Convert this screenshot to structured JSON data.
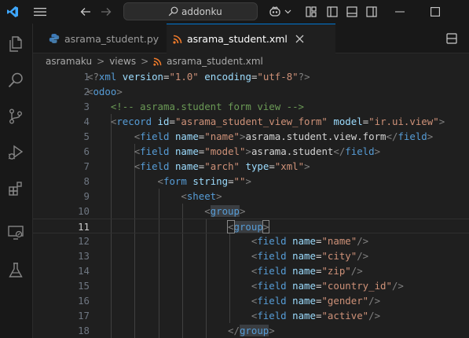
{
  "titlebar": {
    "search_text": "addonku",
    "colors": {
      "accent": "#0078d4",
      "logo": "#3ea7ff"
    }
  },
  "activity_bar": [
    "explorer-icon",
    "search-icon",
    "source-control-icon",
    "run-debug-icon",
    "extensions-icon",
    "remote-explorer-icon",
    "testing-icon"
  ],
  "tabs": [
    {
      "label": "asrama_student.py",
      "icon": "python-icon",
      "active": false
    },
    {
      "label": "asrama_student.xml",
      "icon": "rss-xml-icon",
      "active": true
    }
  ],
  "breadcrumb": {
    "items": [
      "asramaku",
      "views",
      "asrama_student.xml"
    ],
    "separator": ">"
  },
  "editor": {
    "current_line": 11,
    "lines": [
      {
        "n": "1",
        "tokens": [
          [
            "c-bracket",
            "<?"
          ],
          [
            "c-tag",
            "xml"
          ],
          [
            "c-txt",
            " "
          ],
          [
            "c-attr",
            "version"
          ],
          [
            "c-txt",
            "="
          ],
          [
            "c-str",
            "\"1.0\""
          ],
          [
            "c-txt",
            " "
          ],
          [
            "c-attr",
            "encoding"
          ],
          [
            "c-txt",
            "="
          ],
          [
            "c-str",
            "\"utf-8\""
          ],
          [
            "c-bracket",
            "?>"
          ]
        ]
      },
      {
        "n": "2",
        "tokens": [
          [
            "c-bracket",
            "<"
          ],
          [
            "c-tag",
            "odoo"
          ],
          [
            "c-bracket",
            ">"
          ]
        ]
      },
      {
        "n": "3",
        "tokens": [
          [
            "c-txt",
            "    "
          ],
          [
            "c-cmt",
            "<!-- asrama.student form view -->"
          ]
        ]
      },
      {
        "n": "4",
        "tokens": [
          [
            "c-txt",
            "    "
          ],
          [
            "c-bracket",
            "<"
          ],
          [
            "c-tag",
            "record"
          ],
          [
            "c-txt",
            " "
          ],
          [
            "c-attr",
            "id"
          ],
          [
            "c-txt",
            "="
          ],
          [
            "c-str",
            "\"asrama_student_view_form\""
          ],
          [
            "c-txt",
            " "
          ],
          [
            "c-attr",
            "model"
          ],
          [
            "c-txt",
            "="
          ],
          [
            "c-str",
            "\"ir.ui.view\""
          ],
          [
            "c-bracket",
            ">"
          ]
        ]
      },
      {
        "n": "5",
        "tokens": [
          [
            "c-txt",
            "        "
          ],
          [
            "c-bracket",
            "<"
          ],
          [
            "c-tag",
            "field"
          ],
          [
            "c-txt",
            " "
          ],
          [
            "c-attr",
            "name"
          ],
          [
            "c-txt",
            "="
          ],
          [
            "c-str",
            "\"name\""
          ],
          [
            "c-bracket",
            ">"
          ],
          [
            "c-txt",
            "asrama.student.view.form"
          ],
          [
            "c-bracket",
            "</"
          ],
          [
            "c-tag",
            "field"
          ],
          [
            "c-bracket",
            ">"
          ]
        ]
      },
      {
        "n": "6",
        "tokens": [
          [
            "c-txt",
            "        "
          ],
          [
            "c-bracket",
            "<"
          ],
          [
            "c-tag",
            "field"
          ],
          [
            "c-txt",
            " "
          ],
          [
            "c-attr",
            "name"
          ],
          [
            "c-txt",
            "="
          ],
          [
            "c-str",
            "\"model\""
          ],
          [
            "c-bracket",
            ">"
          ],
          [
            "c-txt",
            "asrama.student"
          ],
          [
            "c-bracket",
            "</"
          ],
          [
            "c-tag",
            "field"
          ],
          [
            "c-bracket",
            ">"
          ]
        ]
      },
      {
        "n": "7",
        "tokens": [
          [
            "c-txt",
            "        "
          ],
          [
            "c-bracket",
            "<"
          ],
          [
            "c-tag",
            "field"
          ],
          [
            "c-txt",
            " "
          ],
          [
            "c-attr",
            "name"
          ],
          [
            "c-txt",
            "="
          ],
          [
            "c-str",
            "\"arch\""
          ],
          [
            "c-txt",
            " "
          ],
          [
            "c-attr",
            "type"
          ],
          [
            "c-txt",
            "="
          ],
          [
            "c-str",
            "\"xml\""
          ],
          [
            "c-bracket",
            ">"
          ]
        ]
      },
      {
        "n": "8",
        "tokens": [
          [
            "c-txt",
            "            "
          ],
          [
            "c-bracket",
            "<"
          ],
          [
            "c-tag",
            "form"
          ],
          [
            "c-txt",
            " "
          ],
          [
            "c-attr",
            "string"
          ],
          [
            "c-txt",
            "="
          ],
          [
            "c-str",
            "\"\""
          ],
          [
            "c-bracket",
            ">"
          ]
        ]
      },
      {
        "n": "9",
        "tokens": [
          [
            "c-txt",
            "                "
          ],
          [
            "c-bracket",
            "<"
          ],
          [
            "c-tag",
            "sheet"
          ],
          [
            "c-bracket",
            ">"
          ]
        ]
      },
      {
        "n": "10",
        "tokens": [
          [
            "c-txt",
            "                    "
          ],
          [
            "c-bracket",
            "<"
          ],
          [
            "c-tag hl-grp",
            "group"
          ],
          [
            "c-bracket",
            ">"
          ]
        ]
      },
      {
        "n": "11",
        "tokens": [
          [
            "c-txt",
            "                        "
          ],
          [
            "c-bracket match",
            "<"
          ],
          [
            "c-tag hl-grp",
            "group"
          ],
          [
            "c-bracket match",
            ">"
          ]
        ]
      },
      {
        "n": "12",
        "tokens": [
          [
            "c-txt",
            "                            "
          ],
          [
            "c-bracket",
            "<"
          ],
          [
            "c-tag",
            "field"
          ],
          [
            "c-txt",
            " "
          ],
          [
            "c-attr",
            "name"
          ],
          [
            "c-txt",
            "="
          ],
          [
            "c-str",
            "\"name\""
          ],
          [
            "c-bracket",
            "/>"
          ]
        ]
      },
      {
        "n": "13",
        "tokens": [
          [
            "c-txt",
            "                            "
          ],
          [
            "c-bracket",
            "<"
          ],
          [
            "c-tag",
            "field"
          ],
          [
            "c-txt",
            " "
          ],
          [
            "c-attr",
            "name"
          ],
          [
            "c-txt",
            "="
          ],
          [
            "c-str",
            "\"city\""
          ],
          [
            "c-bracket",
            "/>"
          ]
        ]
      },
      {
        "n": "14",
        "tokens": [
          [
            "c-txt",
            "                            "
          ],
          [
            "c-bracket",
            "<"
          ],
          [
            "c-tag",
            "field"
          ],
          [
            "c-txt",
            " "
          ],
          [
            "c-attr",
            "name"
          ],
          [
            "c-txt",
            "="
          ],
          [
            "c-str",
            "\"zip\""
          ],
          [
            "c-bracket",
            "/>"
          ]
        ]
      },
      {
        "n": "15",
        "tokens": [
          [
            "c-txt",
            "                            "
          ],
          [
            "c-bracket",
            "<"
          ],
          [
            "c-tag",
            "field"
          ],
          [
            "c-txt",
            " "
          ],
          [
            "c-attr",
            "name"
          ],
          [
            "c-txt",
            "="
          ],
          [
            "c-str",
            "\"country_id\""
          ],
          [
            "c-bracket",
            "/>"
          ]
        ]
      },
      {
        "n": "16",
        "tokens": [
          [
            "c-txt",
            "                            "
          ],
          [
            "c-bracket",
            "<"
          ],
          [
            "c-tag",
            "field"
          ],
          [
            "c-txt",
            " "
          ],
          [
            "c-attr",
            "name"
          ],
          [
            "c-txt",
            "="
          ],
          [
            "c-str",
            "\"gender\""
          ],
          [
            "c-bracket",
            "/>"
          ]
        ]
      },
      {
        "n": "17",
        "tokens": [
          [
            "c-txt",
            "                            "
          ],
          [
            "c-bracket",
            "<"
          ],
          [
            "c-tag",
            "field"
          ],
          [
            "c-txt",
            " "
          ],
          [
            "c-attr",
            "name"
          ],
          [
            "c-txt",
            "="
          ],
          [
            "c-str",
            "\"active\""
          ],
          [
            "c-bracket",
            "/>"
          ]
        ]
      },
      {
        "n": "18",
        "tokens": [
          [
            "c-txt",
            "                        "
          ],
          [
            "c-bracket",
            "</"
          ],
          [
            "c-tag hl-grp",
            "group"
          ],
          [
            "c-bracket",
            ">"
          ]
        ]
      }
    ]
  }
}
